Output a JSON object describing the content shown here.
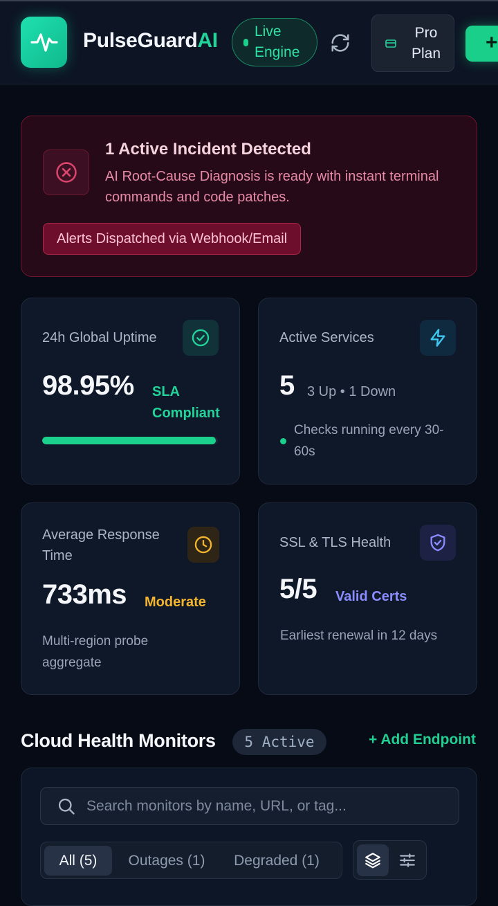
{
  "header": {
    "brand_main": "PulseGuard",
    "brand_accent": "AI",
    "live_label": "Live Engine",
    "pro_label": "Pro Plan",
    "add_label": "+"
  },
  "incident": {
    "title": "1 Active Incident Detected",
    "description": "AI Root-Cause Diagnosis is ready with instant terminal commands and code patches.",
    "badge": "Alerts Dispatched via Webhook/Email"
  },
  "stats": {
    "uptime": {
      "label": "24h Global Uptime",
      "value": "98.95%",
      "note": "SLA Compliant",
      "progress": 0.99
    },
    "services": {
      "label": "Active Services",
      "value": "5",
      "note": "3 Up • 1 Down",
      "detail": "Checks running every 30-60s"
    },
    "response": {
      "label": "Average Response Time",
      "value": "733ms",
      "note": "Moderate",
      "detail": "Multi-region probe aggregate"
    },
    "ssl": {
      "label": "SSL & TLS Health",
      "value": "5/5",
      "note": "Valid Certs",
      "detail": "Earliest renewal in 12 days"
    }
  },
  "monitors": {
    "title": "Cloud Health Monitors",
    "count": "5 Active",
    "add_label": "+ Add Endpoint",
    "search_placeholder": "Search monitors by name, URL, or tag...",
    "filters": [
      "All (5)",
      "Outages (1)",
      "Degraded (1)"
    ]
  },
  "icons": {
    "logo": "pulse-icon",
    "refresh": "refresh-icon",
    "pro": "card-icon",
    "incident": "x-circle-icon",
    "uptime": "check-circle-icon",
    "services": "lightning-icon",
    "response": "clock-icon",
    "ssl": "shield-check-icon",
    "search": "search-icon",
    "layers": "layers-icon",
    "sliders": "sliders-icon"
  },
  "colors": {
    "accent": "#22d39a",
    "danger": "#e04a6c",
    "warning": "#f4b52e",
    "info": "#8b8cff",
    "background": "#060b16"
  }
}
